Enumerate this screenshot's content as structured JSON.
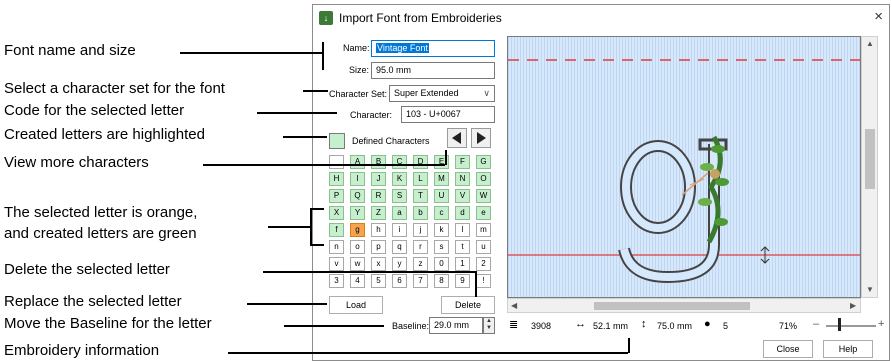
{
  "annotations": {
    "font_name_size": "Font name and size",
    "char_set": "Select a character set for the font",
    "code": "Code for the selected letter",
    "created_highlight": "Created letters are highlighted",
    "view_more": "View more characters",
    "selected_orange_1": "The selected letter is orange,",
    "selected_orange_2": "and created letters are green",
    "delete": "Delete the selected letter",
    "replace": "Replace the selected letter",
    "baseline": "Move the Baseline for the letter",
    "embroidery_info": "Embroidery information"
  },
  "dialog": {
    "title": "Import Font from Embroideries",
    "close_glyph": "×",
    "name_label": "Name:",
    "name_value": "Vintage Font",
    "size_label": "Size:",
    "size_value": "95.0 mm",
    "charset_label": "Character Set:",
    "charset_value": "Super Extended",
    "character_label": "Character:",
    "character_value": "103 - U+0067",
    "defined_label": "Defined Characters",
    "nav_prev": "previous characters",
    "nav_next": "next characters",
    "grid": [
      [
        "",
        "A",
        "B",
        "C",
        "D",
        "E",
        "F",
        "G"
      ],
      [
        "H",
        "I",
        "J",
        "K",
        "L",
        "M",
        "N",
        "O"
      ],
      [
        "P",
        "Q",
        "R",
        "S",
        "T",
        "U",
        "V",
        "W"
      ],
      [
        "X",
        "Y",
        "Z",
        "a",
        "b",
        "c",
        "d",
        "e"
      ],
      [
        "f",
        "g",
        "h",
        "i",
        "j",
        "k",
        "l",
        "m"
      ],
      [
        "n",
        "o",
        "p",
        "q",
        "r",
        "s",
        "t",
        "u"
      ],
      [
        "v",
        "w",
        "x",
        "y",
        "z",
        "0",
        "1",
        "2"
      ],
      [
        "3",
        "4",
        "5",
        "6",
        "7",
        "8",
        "9",
        "!"
      ]
    ],
    "selected_char": "g",
    "load_label": "Load",
    "delete_label": "Delete",
    "baseline_label": "Baseline:",
    "baseline_value": "29.0 mm",
    "status": {
      "stitches": "3908",
      "width": "52.1 mm",
      "height": "75.0 mm",
      "colors": "5",
      "zoom": "71%"
    },
    "close_button": "Close",
    "help_button": "Help",
    "colors": {
      "defined": "#c6efce",
      "selected": "#f6a44f",
      "preview_bg": "#d6e8fb",
      "baseline_line": "#e23c3c"
    }
  }
}
